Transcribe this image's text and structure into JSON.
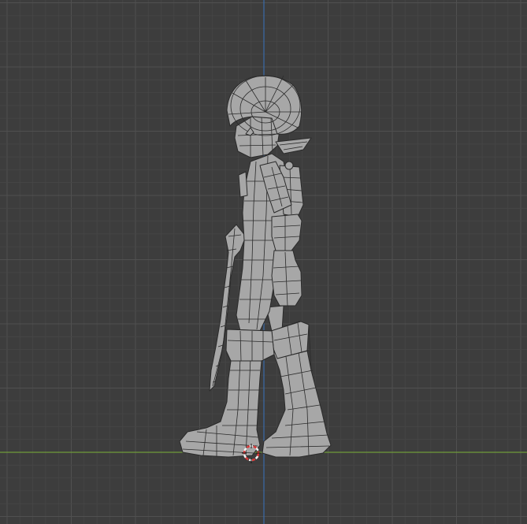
{
  "viewport": {
    "background_color": "#3d3d3d",
    "grid_minor_color": "#464646",
    "grid_major_color": "#505050",
    "axis_z_color": "#3a6aa8",
    "axis_y_color": "#6f9a3a"
  },
  "model": {
    "surface_color": "#a7a7a7",
    "wire_color": "#2a2a2a",
    "shade_color": "#7a7a7a"
  },
  "cursor": {
    "ring_color_a": "#d83a3a",
    "ring_color_b": "#f2f2f2"
  },
  "icons": [
    "3d-cursor-icon"
  ]
}
